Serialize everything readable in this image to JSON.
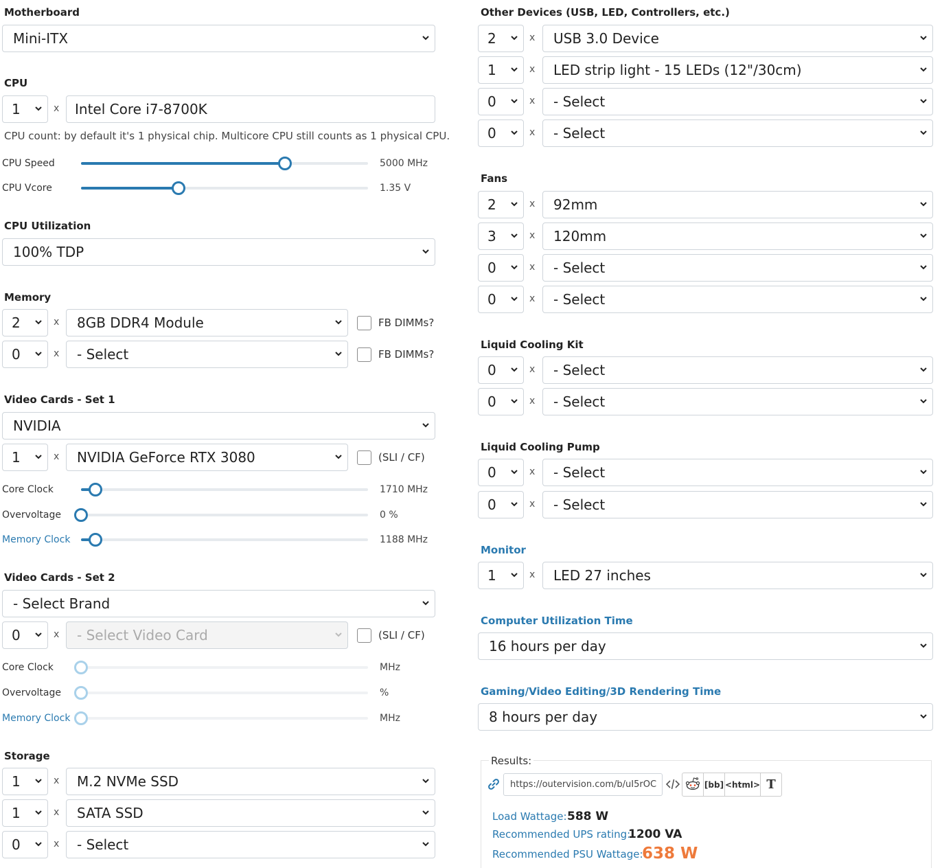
{
  "motherboard": {
    "label": "Motherboard",
    "value": "Mini-ITX"
  },
  "cpu": {
    "label": "CPU",
    "count": "1",
    "x": "x",
    "model": "Intel Core i7-8700K",
    "note": "CPU count: by default it's 1 physical chip. Multicore CPU still counts as 1 physical CPU.",
    "speed_label": "CPU Speed",
    "speed_value": "5000 MHz",
    "speed_level": 0.71,
    "vcore_label": "CPU Vcore",
    "vcore_value": "1.35 V",
    "vcore_level": 0.34
  },
  "cpu_util": {
    "label": "CPU Utilization",
    "value": "100% TDP"
  },
  "memory": {
    "label": "Memory",
    "rows": [
      {
        "count": "2",
        "value": "8GB DDR4 Module",
        "checkbox": "FB DIMMs?"
      },
      {
        "count": "0",
        "value": "- Select",
        "checkbox": "FB DIMMs?"
      }
    ]
  },
  "video1": {
    "label": "Video Cards - Set 1",
    "brand": "NVIDIA",
    "count": "1",
    "card": "NVIDIA GeForce RTX 3080",
    "checkbox": "(SLI / CF)",
    "core_label": "Core Clock",
    "core_value": "1710 MHz",
    "core_level": 0.05,
    "ov_label": "Overvoltage",
    "ov_value": "0 %",
    "ov_level": 0.0,
    "mem_label": "Memory Clock",
    "mem_value": "1188 MHz",
    "mem_level": 0.05
  },
  "video2": {
    "label": "Video Cards - Set 2",
    "brand": "- Select Brand",
    "count": "0",
    "card": "- Select Video Card",
    "checkbox": "(SLI / CF)",
    "core_label": "Core Clock",
    "core_value": "MHz",
    "ov_label": "Overvoltage",
    "ov_value": "%",
    "mem_label": "Memory Clock",
    "mem_value": "MHz"
  },
  "storage": {
    "label": "Storage",
    "rows": [
      {
        "count": "1",
        "value": "M.2 NVMe SSD"
      },
      {
        "count": "1",
        "value": "SATA SSD"
      },
      {
        "count": "0",
        "value": "- Select"
      }
    ]
  },
  "other_devices": {
    "label": "Other Devices (USB, LED, Controllers, etc.)",
    "rows": [
      {
        "count": "2",
        "value": "USB 3.0 Device"
      },
      {
        "count": "1",
        "value": "LED strip light - 15 LEDs (12\"/30cm)"
      },
      {
        "count": "0",
        "value": "- Select"
      },
      {
        "count": "0",
        "value": "- Select"
      }
    ]
  },
  "fans": {
    "label": "Fans",
    "rows": [
      {
        "count": "2",
        "value": "92mm"
      },
      {
        "count": "3",
        "value": "120mm"
      },
      {
        "count": "0",
        "value": "- Select"
      },
      {
        "count": "0",
        "value": "- Select"
      }
    ]
  },
  "liquid_kit": {
    "label": "Liquid Cooling Kit",
    "rows": [
      {
        "count": "0",
        "value": "- Select"
      },
      {
        "count": "0",
        "value": "- Select"
      }
    ]
  },
  "liquid_pump": {
    "label": "Liquid Cooling Pump",
    "rows": [
      {
        "count": "0",
        "value": "- Select"
      },
      {
        "count": "0",
        "value": "- Select"
      }
    ]
  },
  "monitor": {
    "label": "Monitor",
    "count": "1",
    "value": "LED 27 inches"
  },
  "util_time": {
    "label": "Computer Utilization Time",
    "value": "16 hours per day"
  },
  "gaming_time": {
    "label": "Gaming/Video Editing/3D Rendering Time",
    "value": "8 hours per day"
  },
  "results": {
    "title": "Results:",
    "url": "https://outervision.com/b/uI5rOC",
    "share_bb": "[bb]",
    "share_html": "<html>",
    "share_t": "T",
    "load_label": "Load Wattage:",
    "load_value": "588 W",
    "ups_label": "Recommended UPS rating:",
    "ups_value": "1200 VA",
    "psu_label": "Recommended PSU Wattage:",
    "psu_value": "638 W"
  },
  "colors": {
    "accent": "#2a7ab0",
    "highlight": "#ee7a3b"
  }
}
